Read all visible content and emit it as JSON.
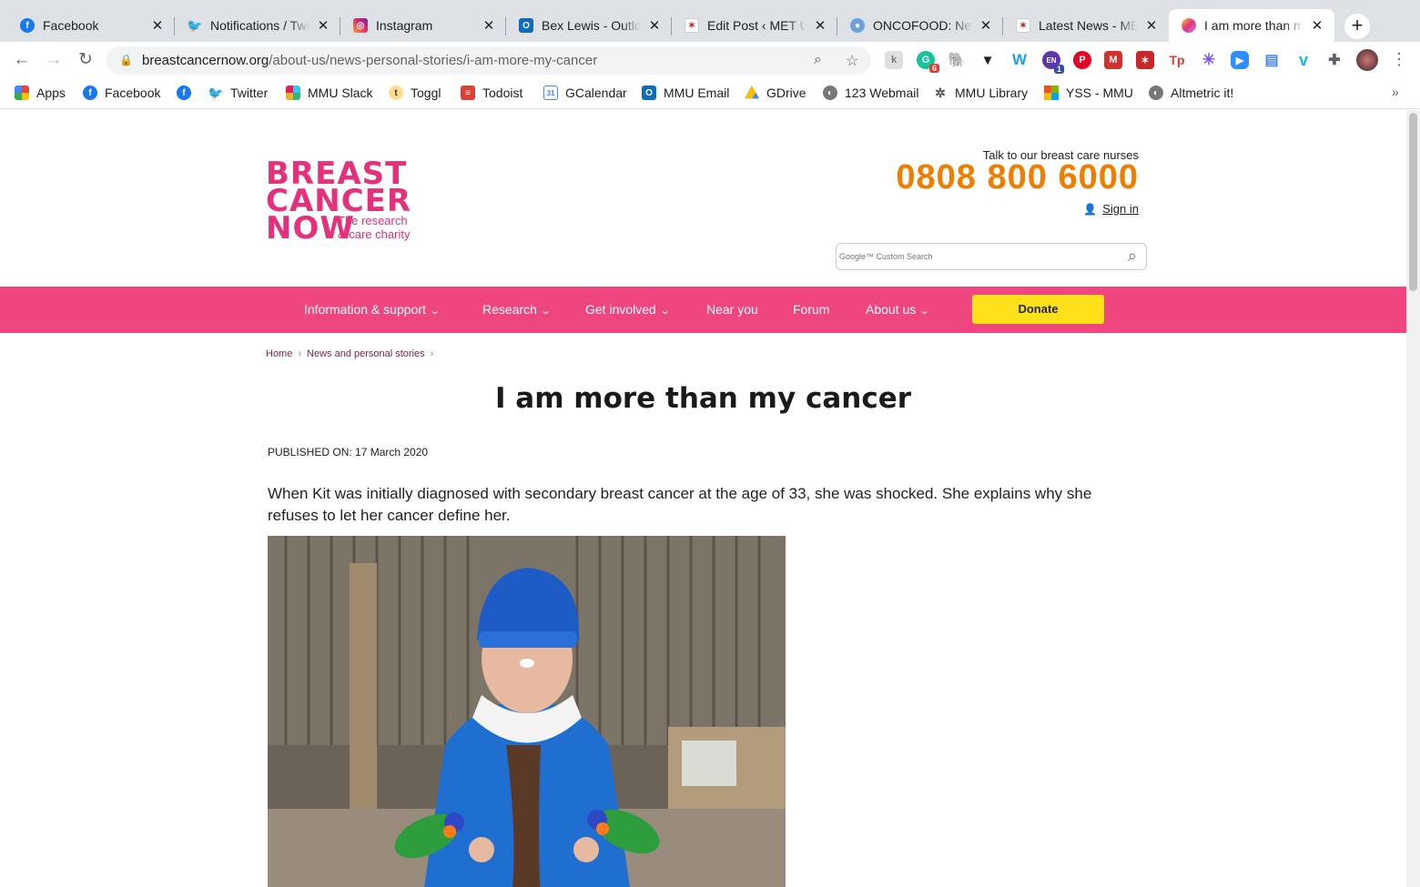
{
  "tabs": [
    {
      "title": "Facebook",
      "icon": "facebook-icon",
      "color": "#1877f2"
    },
    {
      "title": "Notifications / Twitter",
      "icon": "twitter-icon",
      "color": "#1da1f2"
    },
    {
      "title": "Instagram",
      "icon": "instagram-icon",
      "color": "#e1306c"
    },
    {
      "title": "Bex Lewis - Outlook",
      "icon": "outlook-icon",
      "color": "#0f6cbd"
    },
    {
      "title": "Edit Post ‹ MET UP",
      "icon": "met-icon",
      "color": "#c62828"
    },
    {
      "title": "ONCOFOOD: News",
      "icon": "oncofood-icon",
      "color": "#6ca0dc"
    },
    {
      "title": "Latest News - MET",
      "icon": "met-icon",
      "color": "#c62828"
    },
    {
      "title": "I am more than my cancer",
      "icon": "breast-cancer-now-icon",
      "color": "#e5307b"
    }
  ],
  "address_bar": {
    "domain": "breastcancernow.org",
    "path": "/about-us/news-personal-stories/i-am-more-my-cancer"
  },
  "extension_badges": {
    "grammarly": "6",
    "ext_en": "1"
  },
  "bookmarks": [
    {
      "label": "Apps",
      "icon": "apps-grid-icon"
    },
    {
      "label": "Facebook",
      "icon": "facebook-icon"
    },
    {
      "label": "",
      "icon": "facebook-icon"
    },
    {
      "label": "Twitter",
      "icon": "twitter-icon"
    },
    {
      "label": "MMU Slack",
      "icon": "slack-icon"
    },
    {
      "label": "Toggl",
      "icon": "toggl-icon"
    },
    {
      "label": "Todoist",
      "icon": "todoist-icon"
    },
    {
      "label": "GCalendar",
      "icon": "calendar-icon"
    },
    {
      "label": "MMU Email",
      "icon": "outlook-icon"
    },
    {
      "label": "GDrive",
      "icon": "drive-icon"
    },
    {
      "label": "123 Webmail",
      "icon": "globe-icon"
    },
    {
      "label": "MMU Library",
      "icon": "library-icon"
    },
    {
      "label": "YSS - MMU",
      "icon": "microsoft-icon"
    },
    {
      "label": "Altmetric it!",
      "icon": "globe-icon"
    }
  ],
  "site": {
    "logo_text": [
      "BREAST",
      "CANCER",
      "NOW"
    ],
    "logo_tagline": [
      "The research",
      "& care charity"
    ],
    "nurse_label": "Talk to our breast care nurses",
    "phone": "0808 800 6000",
    "sign_in": "Sign in",
    "search_placeholder": "Google™ Custom Search",
    "brand_pink": "#f0467f",
    "phone_orange": "#ef7d00",
    "donate_yellow": "#ffe11a"
  },
  "nav": [
    {
      "label": "Information & support",
      "dropdown": true
    },
    {
      "label": "Research",
      "dropdown": true
    },
    {
      "label": "Get involved",
      "dropdown": true
    },
    {
      "label": "Near you",
      "dropdown": false
    },
    {
      "label": "Forum",
      "dropdown": false
    },
    {
      "label": "About us",
      "dropdown": true
    }
  ],
  "donate_label": "Donate",
  "breadcrumb": [
    "Home",
    "News and personal stories"
  ],
  "article": {
    "title": "I am more than my cancer",
    "published": "PUBLISHED ON: 17 March 2020",
    "intro": "When Kit was initially diagnosed with secondary breast cancer at the age of 33, she was shocked. She explains why she refuses to let her cancer define her."
  }
}
